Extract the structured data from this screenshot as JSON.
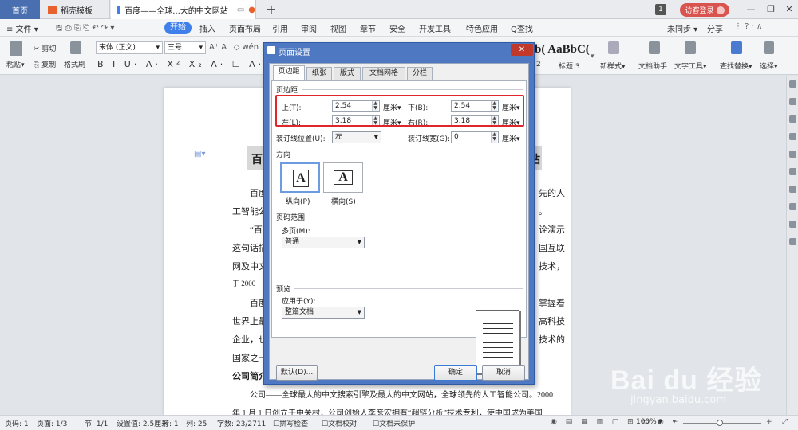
{
  "tabs": {
    "home": "首页",
    "template": "稻壳模板",
    "document": "百度——全球...大的中文网站",
    "badge": "1",
    "guest": "访客登录"
  },
  "menubar": {
    "file": "≡ 文件 ▾",
    "items": [
      "开始",
      "插入",
      "页面布局",
      "引用",
      "审阅",
      "视图",
      "章节",
      "安全",
      "开发工具",
      "特色应用",
      "Q查找"
    ],
    "sync": "未同步 ▾",
    "share": "分享"
  },
  "toolbar": {
    "paste": "粘贴▾",
    "cut": "剪切",
    "copy": "复制",
    "format_painter": "格式刷",
    "font_name": "宋体 (正文)",
    "font_size": "三号",
    "style_preview_1": "b( AaBbC(",
    "style_label_1": "2",
    "style_label_2": "标题 3",
    "new_style": "新样式▾",
    "doc_assistant": "文档助手",
    "text_tools": "文字工具▾",
    "find_replace": "查找替换▾",
    "select": "选择▾"
  },
  "document": {
    "heading_left": "百",
    "heading_right": "站",
    "lines": [
      {
        "text": "百度",
        "right": "先的人"
      },
      {
        "text": "工智能公",
        "right": "。"
      },
      {
        "text": "“百",
        "right": "诠演示"
      },
      {
        "text": "这句话描",
        "right": "国互联"
      },
      {
        "text": "网及中文",
        "right": "技术，"
      },
      {
        "text": "于  2000",
        "right": ""
      },
      {
        "text": "百度",
        "right": "掌握着"
      },
      {
        "text": "世界上最",
        "right": "高科技"
      },
      {
        "text": "企业，也",
        "right": "技术的"
      },
      {
        "text": "国家之一",
        "right": ""
      },
      {
        "text": "公司简介",
        "right": ""
      },
      {
        "text": "公司——全球最大的中文搜索引擎及最大的中文网站，全球领先的人工智能公司。2000",
        "right": ""
      },
      {
        "text": "年 1 月 1 日创立于中关村，公司创始人李彦宏拥有“超链分析”技术专利，使中国成为美国",
        "right": ""
      }
    ]
  },
  "dialog": {
    "title": "页面设置",
    "close": "✕",
    "tabs": [
      "页边距",
      "纸张",
      "版式",
      "文档网格",
      "分栏"
    ],
    "margins_group": "页边距",
    "top_label": "上(T):",
    "top_value": "2.54",
    "bottom_label": "下(B):",
    "bottom_value": "2.54",
    "left_label": "左(L):",
    "left_value": "3.18",
    "right_label": "右(R):",
    "right_value": "3.18",
    "unit": "厘米▾",
    "gutter_pos_label": "装订线位置(U):",
    "gutter_pos_value": "左",
    "gutter_width_label": "装订线宽(G):",
    "gutter_width_value": "0",
    "orientation_group": "方向",
    "portrait": "纵向(P)",
    "landscape": "横向(S)",
    "pages_group": "页码范围",
    "multi_pages_label": "多页(M):",
    "multi_pages_value": "普通",
    "preview_group": "预览",
    "apply_to_label": "应用于(Y):",
    "apply_to_value": "整篇文档",
    "default_button": "默认(D)...",
    "ok_button": "确定",
    "cancel_button": "取消"
  },
  "statusbar": {
    "page_num": "页码: 1",
    "pages": "页面: 1/3",
    "section": "节: 1/1",
    "setting": "设置值: 2.5厘米",
    "row": "行: 1",
    "col": "列: 25",
    "words": "字数: 23/2711",
    "spell": "拼写检查",
    "proof": "文档校对",
    "protect": "文档未保护",
    "zoom": "100% ▾"
  },
  "watermark": {
    "brand": "Bai du 经验",
    "url": "jingyan.baidu.com"
  },
  "colors": {
    "accent": "#3f80ea",
    "dialog_title": "#4f78c2",
    "highlight": "#e0262a"
  }
}
